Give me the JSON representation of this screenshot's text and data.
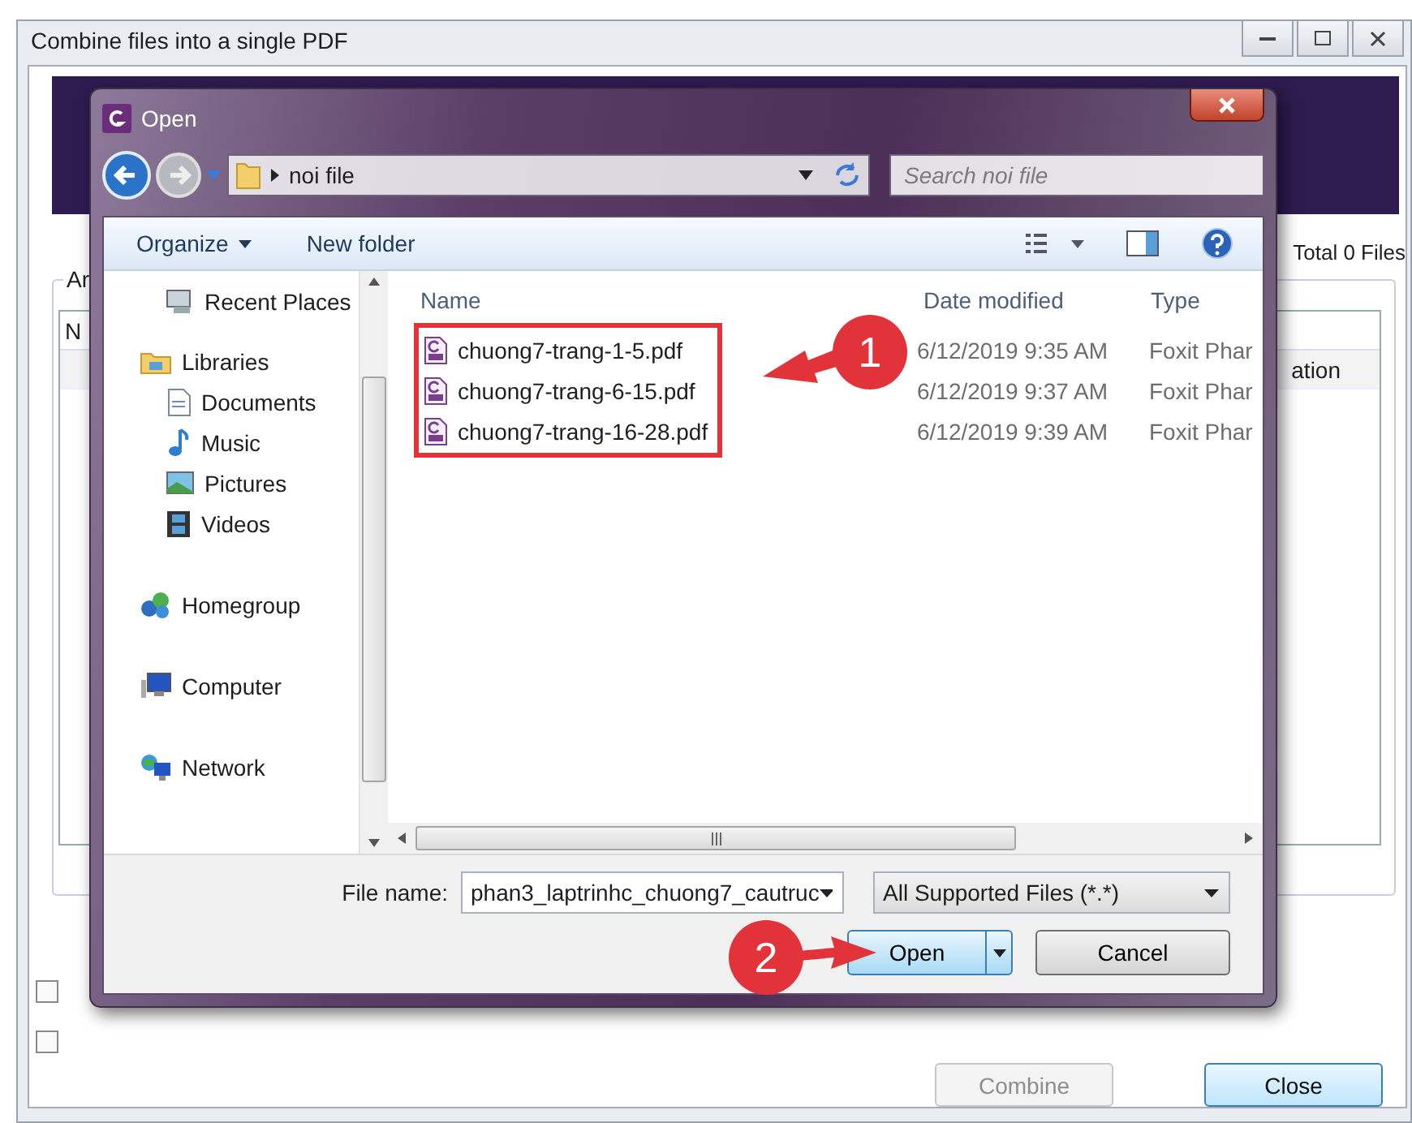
{
  "background_window": {
    "title": "Combine files into a single PDF",
    "total": "Total 0 Files",
    "group_label": "Ar",
    "column_1": "N",
    "row_cell": "ation",
    "checkboxes": [
      {
        "checked": false
      },
      {
        "checked": false
      }
    ],
    "buttons": [
      {
        "label": "Combine",
        "disabled": true
      },
      {
        "label": "Close",
        "disabled": false
      }
    ]
  },
  "dialog": {
    "title": "Open",
    "address": "noi file",
    "search": {
      "placeholder": "Search noi file"
    },
    "toolbar": [
      "Organize",
      "New folder"
    ],
    "nav": [
      {
        "children": [
          {
            "label": "Recent Places",
            "kind": "recent"
          }
        ]
      },
      {
        "label": "Libraries",
        "kind": "library",
        "children": [
          {
            "label": "Documents",
            "kind": "document"
          },
          {
            "label": "Music",
            "kind": "music"
          },
          {
            "label": "Pictures",
            "kind": "pictures"
          },
          {
            "label": "Videos",
            "kind": "videos"
          }
        ]
      },
      {
        "label": "Homegroup",
        "kind": "homegroup"
      },
      {
        "label": "Computer",
        "kind": "computer"
      },
      {
        "label": "Network",
        "kind": "network"
      }
    ],
    "columns": [
      "Name",
      "Date modified",
      "Type"
    ],
    "files": [
      {
        "name": "chuong7-trang-1-5.pdf",
        "date": "6/12/2019 9:35 AM",
        "type": "Foxit Phar"
      },
      {
        "name": "chuong7-trang-6-15.pdf",
        "date": "6/12/2019 9:37 AM",
        "type": "Foxit Phar"
      },
      {
        "name": "chuong7-trang-16-28.pdf",
        "date": "6/12/2019 9:39 AM",
        "type": "Foxit Phar"
      }
    ],
    "file_name_label": "File name:",
    "file_name": "phan3_laptrinhc_chuong7_cautruc",
    "file_type": "All Supported Files (*.*)",
    "buttons": [
      "Open",
      "Cancel"
    ]
  },
  "callouts": [
    "1",
    "2"
  ]
}
